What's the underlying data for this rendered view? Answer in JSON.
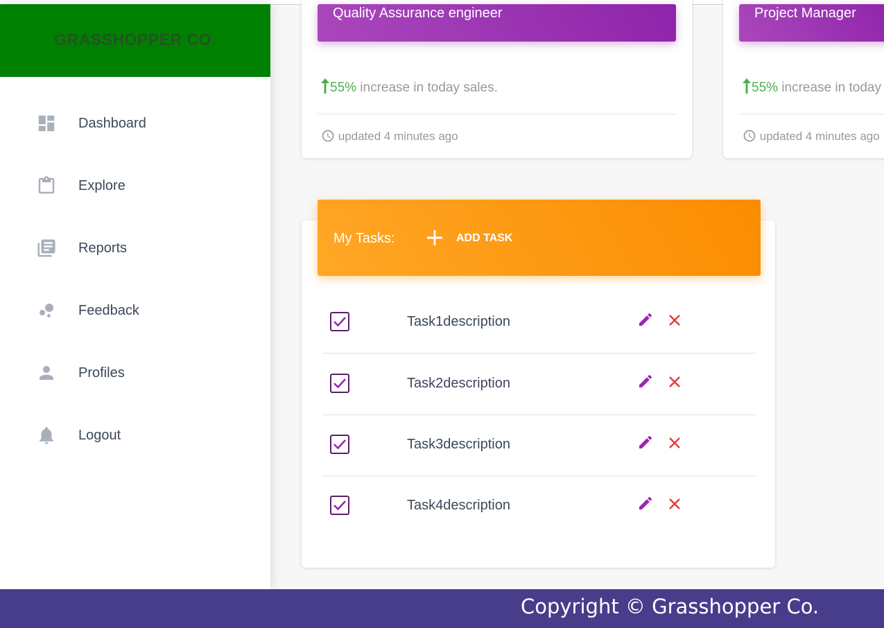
{
  "brand": {
    "name": "GRASSHOPPER CO."
  },
  "sidebar": {
    "items": [
      {
        "label": "Dashboard",
        "icon": "dashboard-icon"
      },
      {
        "label": "Explore",
        "icon": "clipboard-icon"
      },
      {
        "label": "Reports",
        "icon": "library-books-icon"
      },
      {
        "label": "Feedback",
        "icon": "bubbles-icon"
      },
      {
        "label": "Profiles",
        "icon": "person-icon"
      },
      {
        "label": "Logout",
        "icon": "bell-icon"
      }
    ]
  },
  "cards": [
    {
      "title": "Quality Assurance engineer",
      "pct": "55%",
      "stat_text": " increase in today sales.",
      "updated": "updated 4 minutes ago"
    },
    {
      "title": "Project Manager",
      "pct": "55%",
      "stat_text": " increase in today sales.",
      "updated": "updated 4 minutes ago"
    }
  ],
  "tasks": {
    "title": "My Tasks:",
    "add_label": "ADD TASK",
    "items": [
      {
        "description": "Task1description",
        "checked": true
      },
      {
        "description": "Task2description",
        "checked": true
      },
      {
        "description": "Task3description",
        "checked": true
      },
      {
        "description": "Task4description",
        "checked": true
      }
    ]
  },
  "footer": {
    "text": "Copyright © Grasshopper Co."
  },
  "colors": {
    "brand_green": "#008000",
    "card_purple": "#9c27b0",
    "task_orange": "#fb8c00",
    "footer_purple": "#483d8b",
    "stat_green": "#4caf50",
    "delete_red": "#e53935"
  }
}
